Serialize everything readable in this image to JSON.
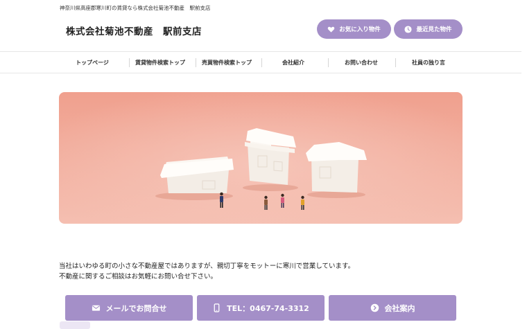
{
  "header": {
    "tagline": "神奈川県高座郡寒川町の賃貸なら株式会社菊池不動産　駅前支店",
    "site_title": "株式会社菊池不動産　駅前支店",
    "favorites_label": "お気に入り物件",
    "recent_label": "最近見た物件"
  },
  "nav": {
    "items": [
      {
        "label": "トップページ"
      },
      {
        "label": "賃貸物件検索トップ"
      },
      {
        "label": "売買物件検索トップ"
      },
      {
        "label": "会社紹介"
      },
      {
        "label": "お問い合わせ"
      },
      {
        "label": "社員の独り言"
      }
    ]
  },
  "intro": {
    "line1": "当社はいわゆる町の小さな不動産屋ではありますが、親切丁寧をモットーに寒川で営業しています。",
    "line2": "不動産に関するご相談はお気軽にお問い合せ下さい。"
  },
  "cta": {
    "mail_label": "メールでお問合せ",
    "tel_label": "TEL：0467-74-3312",
    "company_label": "会社案内"
  },
  "colors": {
    "accent": "#a48fc8",
    "hero_bg": "#ee9f8d"
  },
  "icons": {
    "favorites": "heart-icon",
    "recent": "clock-icon",
    "mail": "mail-icon",
    "tel": "phone-icon",
    "company": "chevron-circle-icon"
  }
}
